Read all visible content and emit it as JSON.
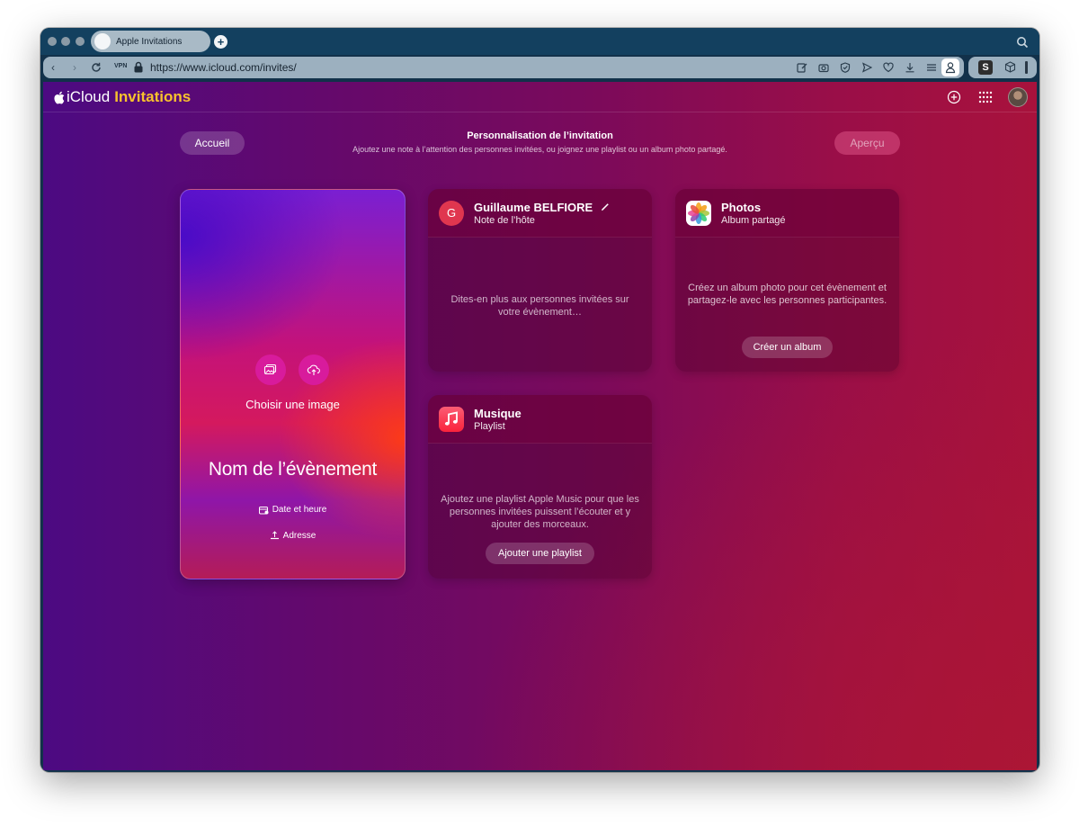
{
  "browser": {
    "tab_title": "Apple Invitations",
    "vpn_label": "VPN",
    "url": "https://www.icloud.com/invites/",
    "extension_label": "S"
  },
  "app": {
    "logo_text": "iCloud",
    "logo_accent": "Invitations",
    "accent_color": "#f8c22d"
  },
  "header": {
    "home_button": "Accueil",
    "title": "Personnalisation de l’invitation",
    "subtitle": "Ajoutez une note à l’attention des personnes invitées, ou joignez une playlist ou un album photo partagé.",
    "preview_button": "Aperçu"
  },
  "event": {
    "choose_image": "Choisir une image",
    "name": "Nom de l’évènement",
    "date_label": "Date et heure",
    "address_label": "Adresse"
  },
  "host_card": {
    "initial": "G",
    "title": "Guillaume BELFIORE",
    "subtitle": "Note de l’hôte",
    "body": "Dites-en plus aux personnes invitées sur votre évènement…"
  },
  "photos_card": {
    "title": "Photos",
    "subtitle": "Album partagé",
    "body": "Créez un album photo pour cet évènement et partagez-le avec les personnes participantes.",
    "button": "Créer un album"
  },
  "music_card": {
    "title": "Musique",
    "subtitle": "Playlist",
    "body": "Ajoutez une playlist Apple Music pour que les personnes invitées puissent l’écouter et y ajouter des morceaux.",
    "button": "Ajouter une playlist"
  }
}
